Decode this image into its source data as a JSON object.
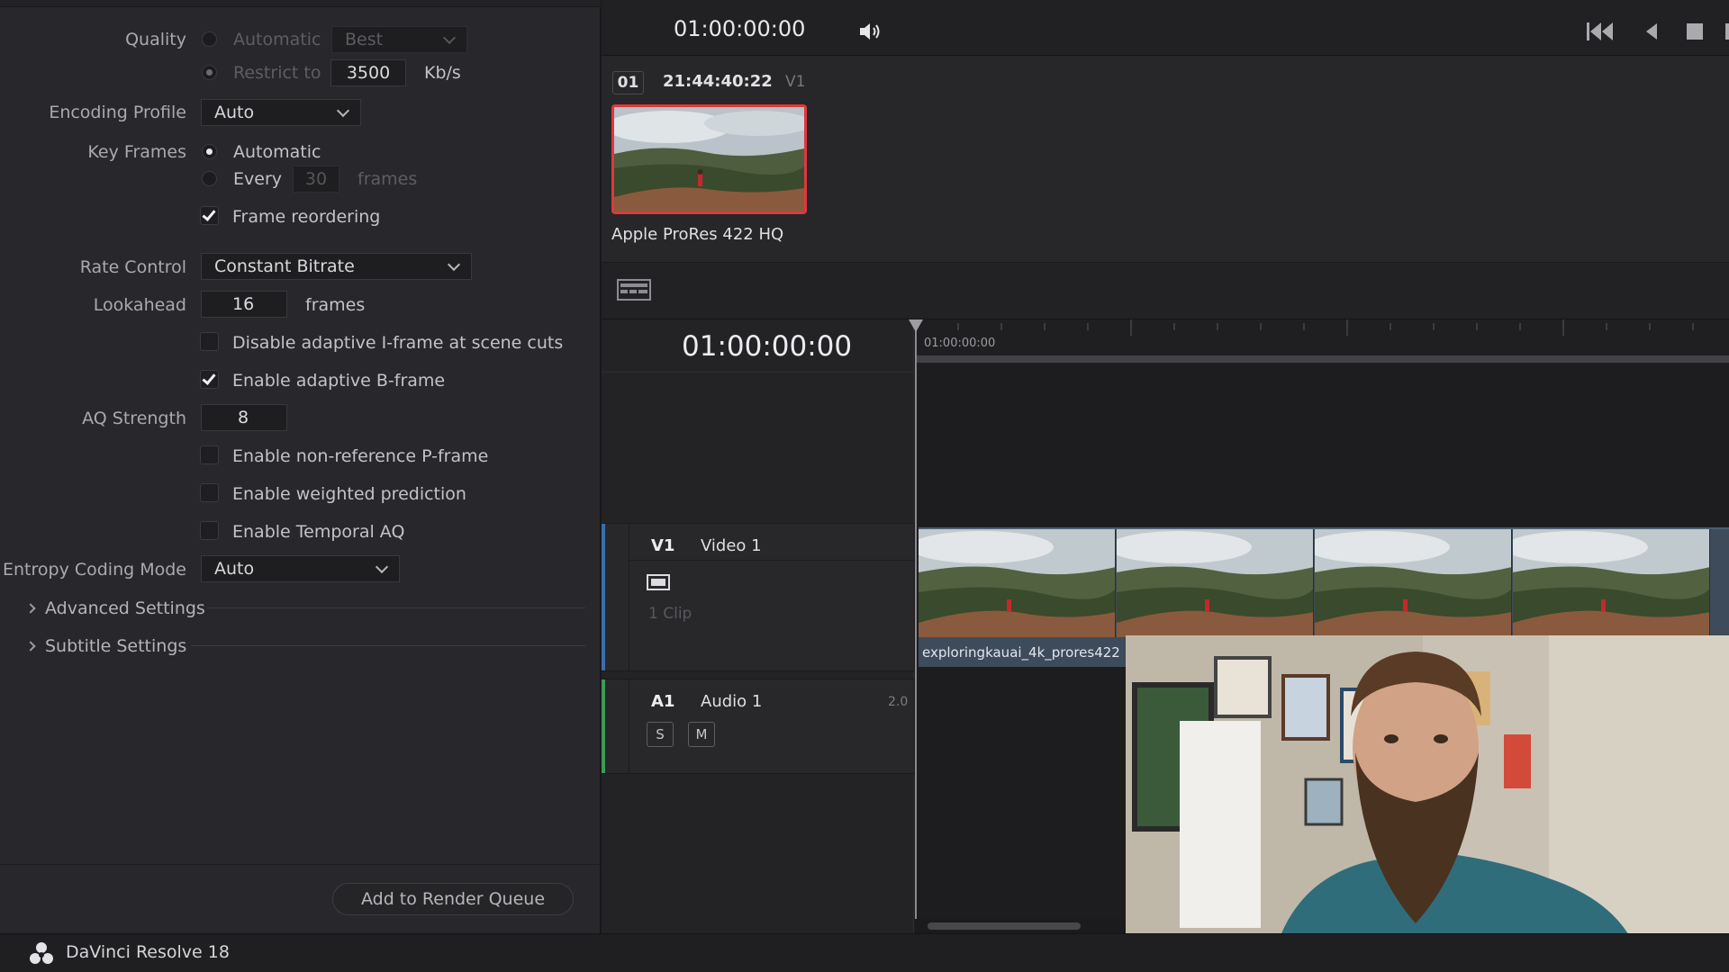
{
  "render_settings": {
    "quality": {
      "label": "Quality",
      "automatic_label": "Automatic",
      "best_value": "Best",
      "restrict_label": "Restrict to",
      "restrict_value": "3500",
      "unit": "Kb/s"
    },
    "encoding_profile": {
      "label": "Encoding Profile",
      "value": "Auto"
    },
    "key_frames": {
      "label": "Key Frames",
      "automatic_label": "Automatic",
      "every_label": "Every",
      "every_value": "30",
      "frames_label": "frames",
      "frame_reordering_label": "Frame reordering"
    },
    "rate_control": {
      "label": "Rate Control",
      "value": "Constant Bitrate"
    },
    "lookahead": {
      "label": "Lookahead",
      "value": "16",
      "unit": "frames"
    },
    "disable_adaptive_iframe_label": "Disable adaptive I-frame at scene cuts",
    "enable_adaptive_bframe_label": "Enable adaptive B-frame",
    "aq_strength": {
      "label": "AQ Strength",
      "value": "8"
    },
    "enable_nonref_pframe_label": "Enable non-reference P-frame",
    "enable_weighted_prediction_label": "Enable weighted prediction",
    "enable_temporal_aq_label": "Enable Temporal AQ",
    "entropy_coding": {
      "label": "Entropy Coding Mode",
      "value": "Auto"
    },
    "advanced_settings_label": "Advanced Settings",
    "subtitle_settings_label": "Subtitle Settings",
    "add_to_queue_label": "Add to Render Queue"
  },
  "status_bar": {
    "app_name": "DaVinci Resolve 18"
  },
  "viewer": {
    "timecode": "01:00:00:00"
  },
  "clip": {
    "number": "01",
    "timecode": "21:44:40:22",
    "track": "V1",
    "codec": "Apple ProRes 422 HQ"
  },
  "timeline": {
    "timecode": "01:00:00:00",
    "ruler_label": "01:00:00:00",
    "video_track": {
      "id": "V1",
      "name": "Video 1",
      "clip_count": "1 Clip"
    },
    "audio_track": {
      "id": "A1",
      "name": "Audio 1",
      "channels": "2.0",
      "solo": "S",
      "mute": "M"
    },
    "clip_filename": "exploringkauai_4k_prores422"
  },
  "colors": {
    "accent_red": "#e0373f",
    "video_track_stripe": "#3b6ea8",
    "audio_track_stripe": "#3e9a55",
    "clip_blue": "#3d4b5a"
  }
}
